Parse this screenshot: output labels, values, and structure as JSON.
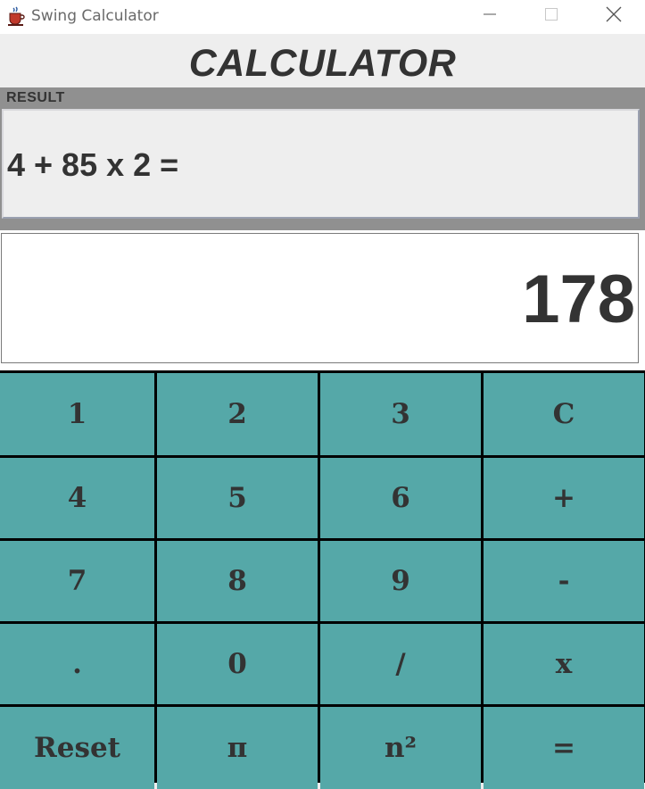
{
  "window": {
    "title": "Swing Calculator",
    "icon": "java-cup-icon",
    "controls": [
      "minimize-icon",
      "maximize-icon",
      "close-icon"
    ]
  },
  "heading": "CALCULATOR",
  "result": {
    "legend": "RESULT",
    "expression": "4 + 85 x 2 ="
  },
  "display": {
    "value": "178"
  },
  "keys": [
    [
      "1",
      "2",
      "3",
      "C"
    ],
    [
      "4",
      "5",
      "6",
      "+"
    ],
    [
      "7",
      "8",
      "9",
      "-"
    ],
    [
      ".",
      "0",
      "/",
      "x"
    ],
    [
      "Reset",
      "π",
      "n²",
      "="
    ]
  ],
  "colors": {
    "key_background": "#55a8a8",
    "key_text": "#333333",
    "grid_lines": "#000000",
    "panel_background": "#eeeeee",
    "titled_border": "#909090"
  }
}
